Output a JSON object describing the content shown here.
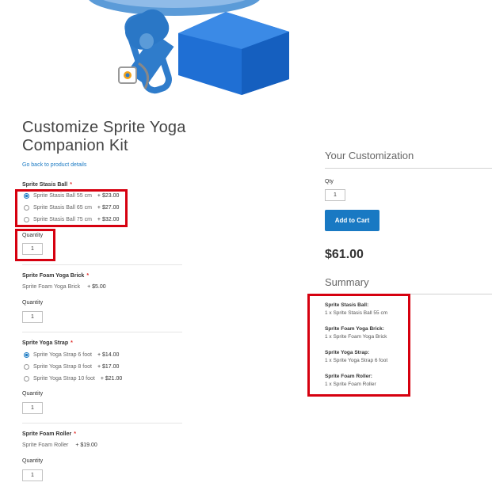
{
  "page": {
    "title": "Customize Sprite Yoga Companion Kit",
    "back_link": "Go back to product details"
  },
  "options": {
    "stasis_ball": {
      "label": "Sprite Stasis Ball",
      "choices": [
        {
          "name": "Sprite Stasis Ball 55 cm",
          "price": "+ $23.00",
          "selected": true
        },
        {
          "name": "Sprite Stasis Ball 65 cm",
          "price": "+ $27.00",
          "selected": false
        },
        {
          "name": "Sprite Stasis Ball 75 cm",
          "price": "+ $32.00",
          "selected": false
        }
      ],
      "qty_label": "Quantity",
      "qty": "1"
    },
    "foam_brick": {
      "label": "Sprite Foam Yoga Brick",
      "item": "Sprite Foam Yoga Brick",
      "price": "+ $5.00",
      "qty_label": "Quantity",
      "qty": "1"
    },
    "yoga_strap": {
      "label": "Sprite Yoga Strap",
      "choices": [
        {
          "name": "Sprite Yoga Strap 6 foot",
          "price": "+ $14.00",
          "selected": true
        },
        {
          "name": "Sprite Yoga Strap 8 foot",
          "price": "+ $17.00",
          "selected": false
        },
        {
          "name": "Sprite Yoga Strap 10 foot",
          "price": "+ $21.00",
          "selected": false
        }
      ],
      "qty_label": "Quantity",
      "qty": "1"
    },
    "foam_roller": {
      "label": "Sprite Foam Roller",
      "item": "Sprite Foam Roller",
      "price": "+ $19.00",
      "qty_label": "Quantity",
      "qty": "1"
    }
  },
  "customization": {
    "title": "Your Customization",
    "qty_label": "Qty",
    "qty": "1",
    "add_to_cart": "Add to Cart",
    "total": "$61.00"
  },
  "summary": {
    "title": "Summary",
    "items": [
      {
        "name": "Sprite Stasis Ball:",
        "value": "1 x Sprite Stasis Ball 55 cm"
      },
      {
        "name": "Sprite Foam Yoga Brick:",
        "value": "1 x Sprite Foam Yoga Brick"
      },
      {
        "name": "Sprite Yoga Strap:",
        "value": "1 x Sprite Yoga Strap 6 foot"
      },
      {
        "name": "Sprite Foam Roller:",
        "value": "1 x Sprite Foam Roller"
      }
    ]
  },
  "colors": {
    "accent": "#1979c3",
    "required": "#e02b27",
    "highlight": "#d6000f"
  }
}
